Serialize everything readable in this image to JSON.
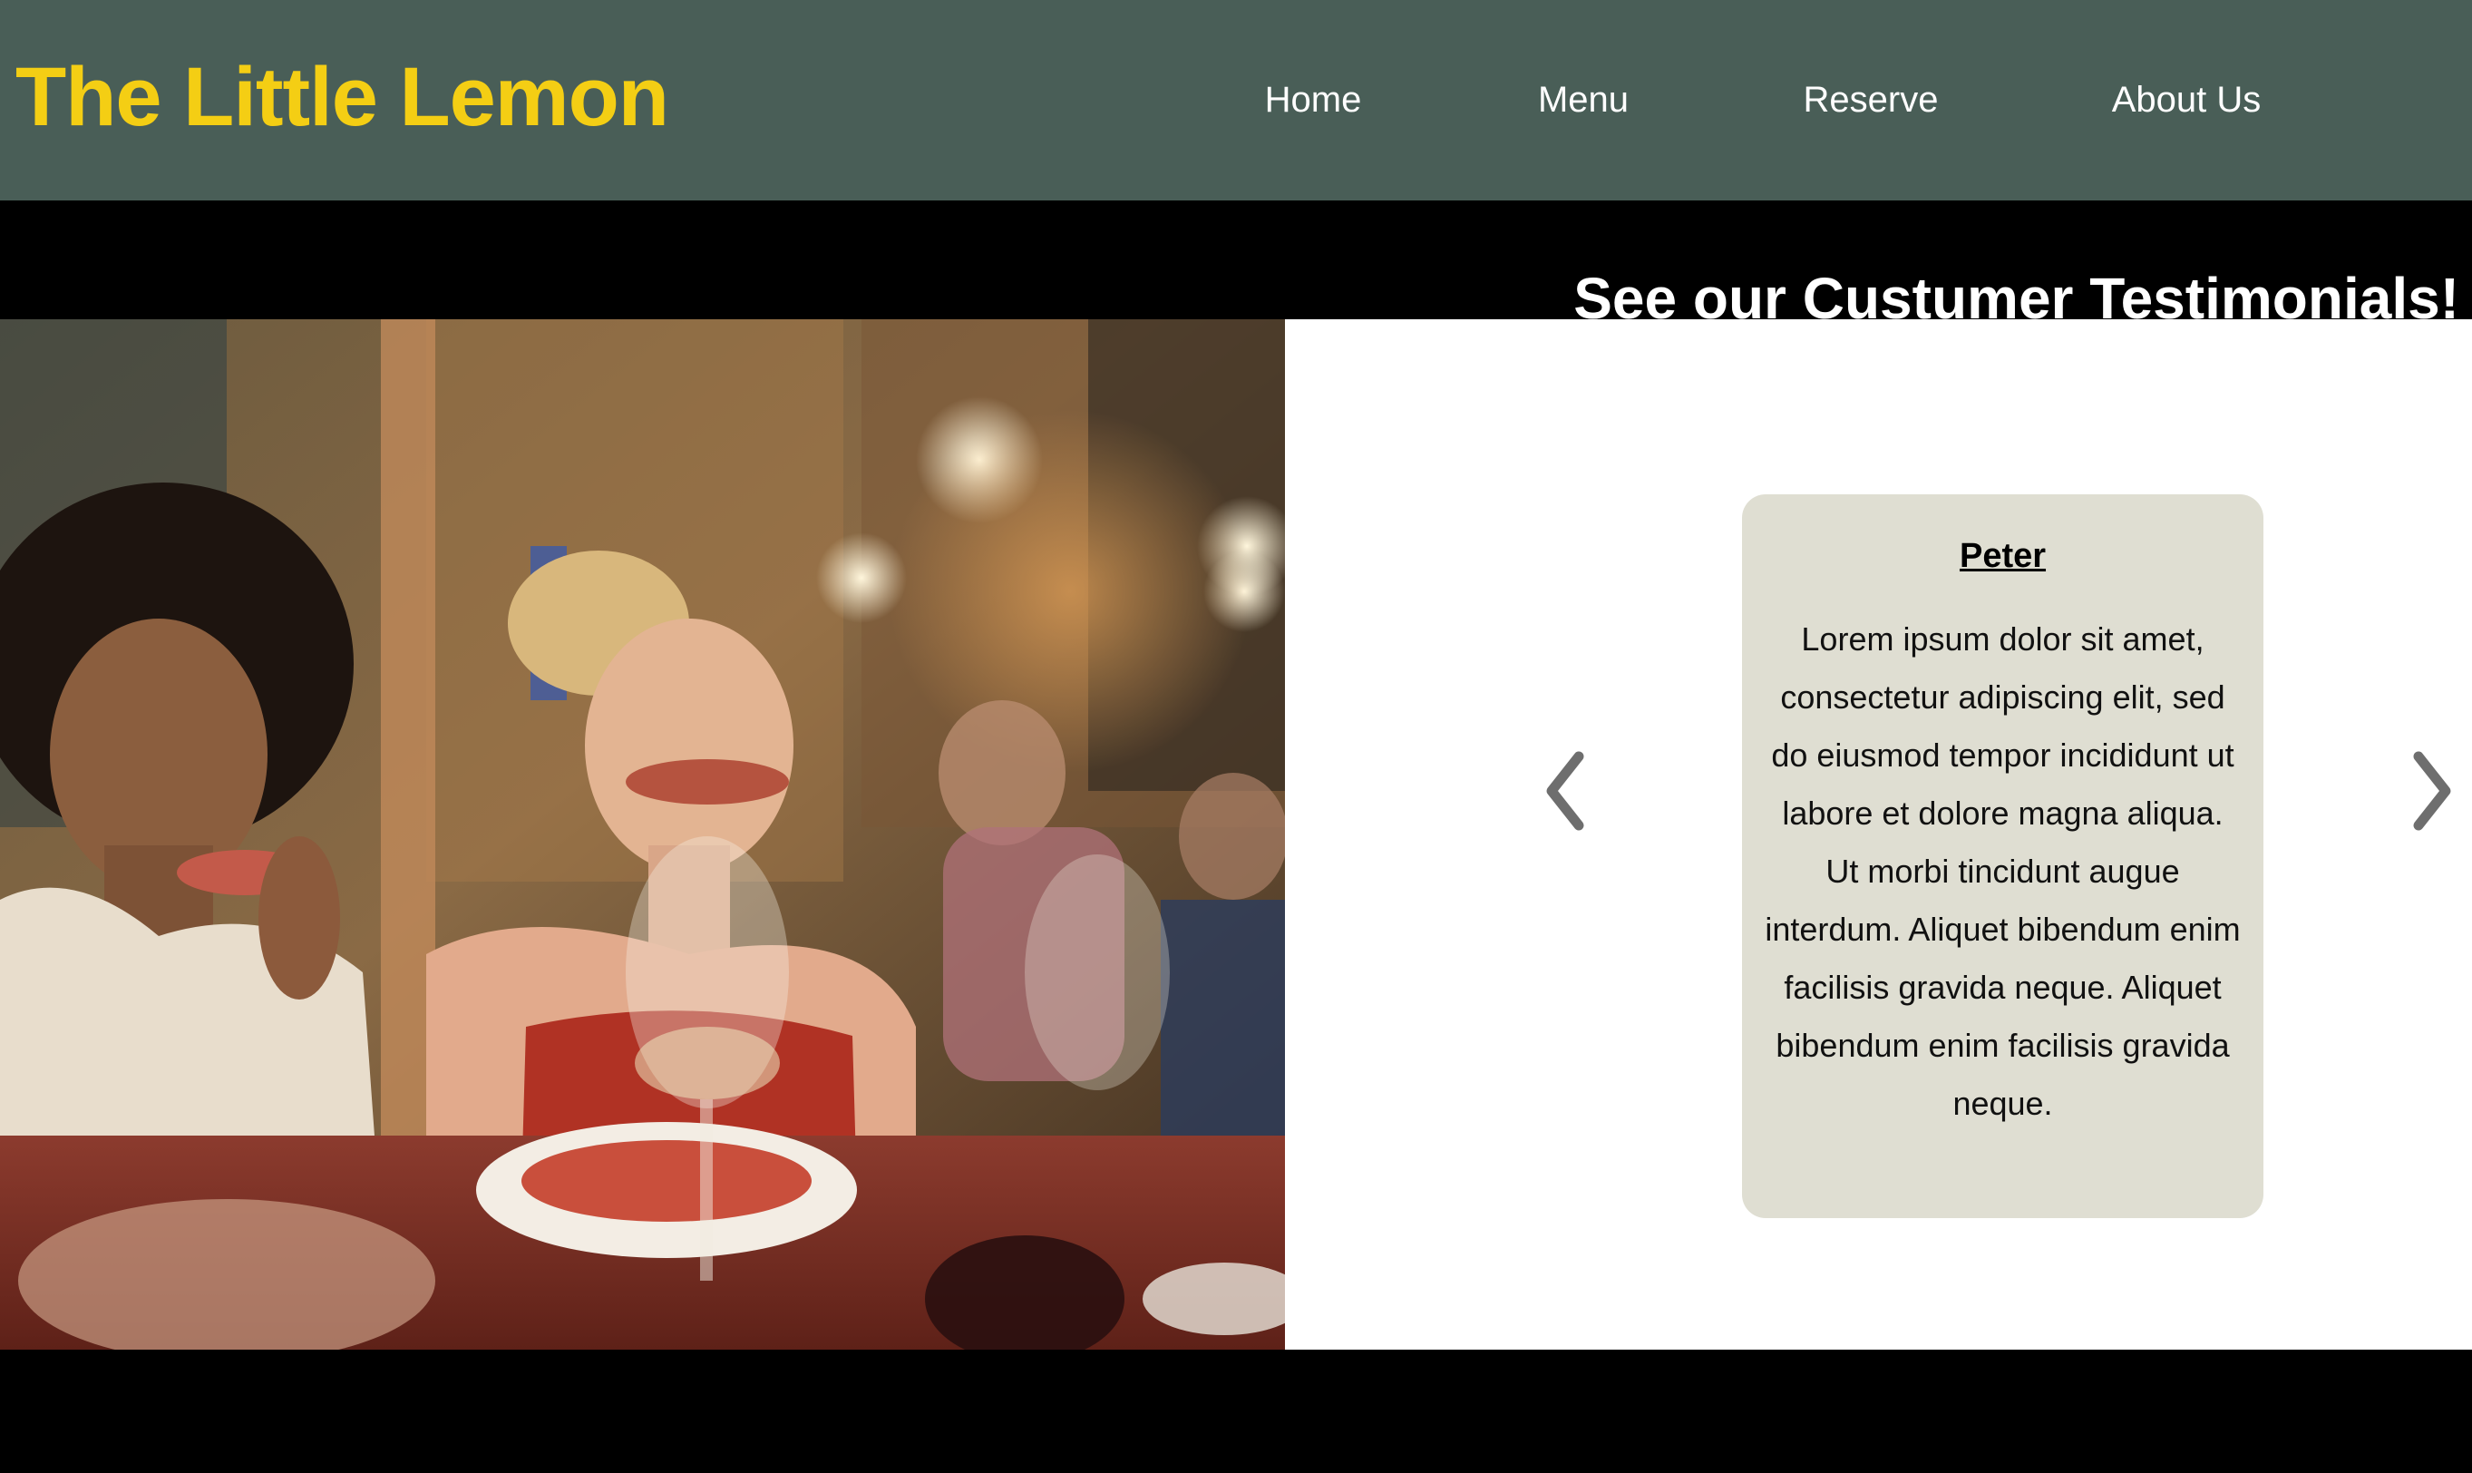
{
  "header": {
    "brand": "The Little Lemon",
    "nav": [
      "Home",
      "Menu",
      "Reserve",
      "About Us"
    ]
  },
  "banner": {
    "title": "See our Custumer Testimonials!"
  },
  "testimonial": {
    "name": "Peter",
    "text": "Lorem ipsum dolor sit amet, consectetur adipiscing elit, sed do eiusmod tempor incididunt ut labore et dolore magna aliqua. Ut morbi tincidunt augue interdum. Aliquet bibendum enim facilisis gravida neque. Aliquet bibendum enim facilisis gravida neque."
  },
  "icons": {
    "prev": "chevron-left-icon",
    "next": "chevron-right-icon"
  },
  "colors": {
    "header_bg": "#495e57",
    "brand": "#f4ce14",
    "card_bg": "#dfded2",
    "arrow": "#6e6e6e"
  }
}
